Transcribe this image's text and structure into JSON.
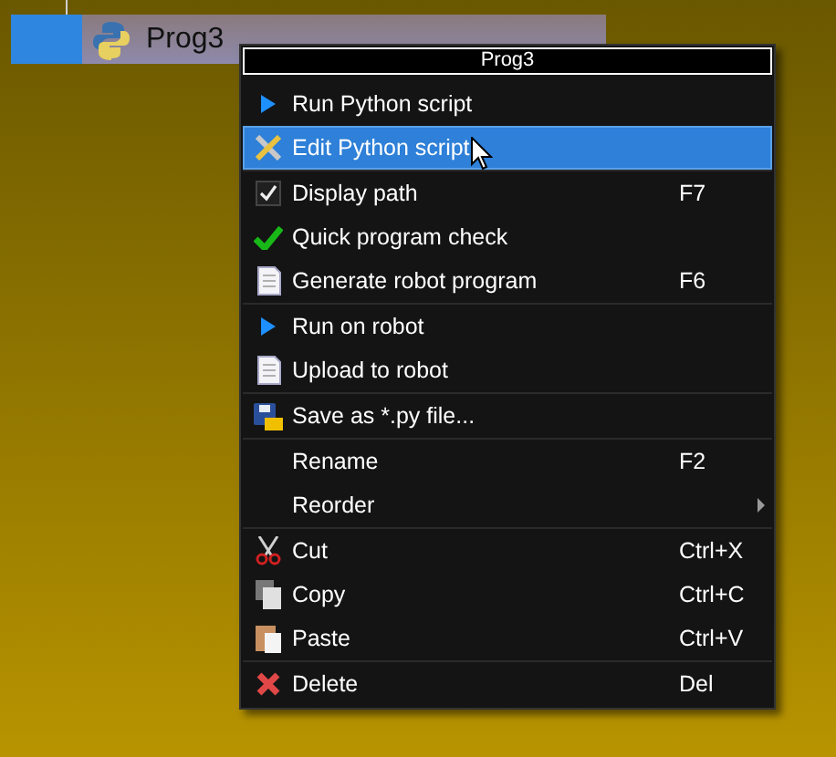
{
  "tree": {
    "items": [
      {
        "label": "Prog3",
        "selected": true
      }
    ]
  },
  "context_menu": {
    "title": "Prog3",
    "items": [
      {
        "kind": "item",
        "label": "Run Python script",
        "selected": false
      },
      {
        "kind": "item",
        "label": "Edit Python script",
        "selected": true
      },
      {
        "kind": "separator"
      },
      {
        "kind": "check",
        "label": "Display path",
        "shortcut": "F7",
        "checked": true,
        "selected": false
      },
      {
        "kind": "item",
        "label": "Quick program check",
        "selected": false
      },
      {
        "kind": "item",
        "label": "Generate robot program",
        "shortcut": "F6",
        "selected": false
      },
      {
        "kind": "separator"
      },
      {
        "kind": "item",
        "label": "Run on robot",
        "selected": false
      },
      {
        "kind": "item",
        "label": "Upload to robot",
        "selected": false
      },
      {
        "kind": "separator"
      },
      {
        "kind": "item",
        "label": "Save as *.py file...",
        "selected": false
      },
      {
        "kind": "separator"
      },
      {
        "kind": "item",
        "label": "Rename",
        "shortcut": "F2",
        "selected": false
      },
      {
        "kind": "submenu",
        "label": "Reorder",
        "selected": false
      },
      {
        "kind": "separator"
      },
      {
        "kind": "item",
        "label": "Cut",
        "shortcut": "Ctrl+X",
        "selected": false
      },
      {
        "kind": "item",
        "label": "Copy",
        "shortcut": "Ctrl+C",
        "selected": false
      },
      {
        "kind": "item",
        "label": "Paste",
        "shortcut": "Ctrl+V",
        "selected": false
      },
      {
        "kind": "separator"
      },
      {
        "kind": "item",
        "label": "Delete",
        "shortcut": "Del",
        "selected": false
      }
    ]
  }
}
